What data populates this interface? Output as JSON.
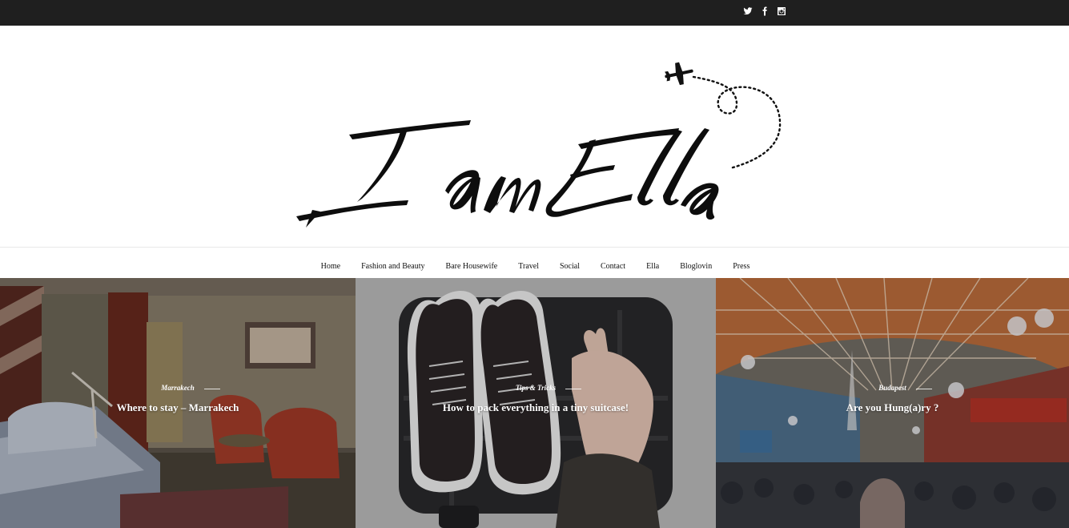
{
  "social": {
    "twitter": "twitter-icon",
    "facebook": "facebook-icon",
    "instagram": "instagram-icon"
  },
  "brand": {
    "logo_text": "I am Ella"
  },
  "nav": {
    "items": [
      "Home",
      "Fashion and Beauty",
      "Bare Housewife",
      "Travel",
      "Social",
      "Contact",
      "Ella",
      "Bloglovin",
      "Press"
    ]
  },
  "slides": [
    {
      "category": "Marrakech",
      "title": "Where to stay – Marrakech"
    },
    {
      "category": "Tips & Tricks",
      "title": "How to pack everything in a tiny suitcase!"
    },
    {
      "category": "Budapest",
      "title": "Are you Hung(a)ry ?"
    }
  ],
  "colors": {
    "topbar": "#1f1f1f",
    "accent_text": "#111111"
  }
}
